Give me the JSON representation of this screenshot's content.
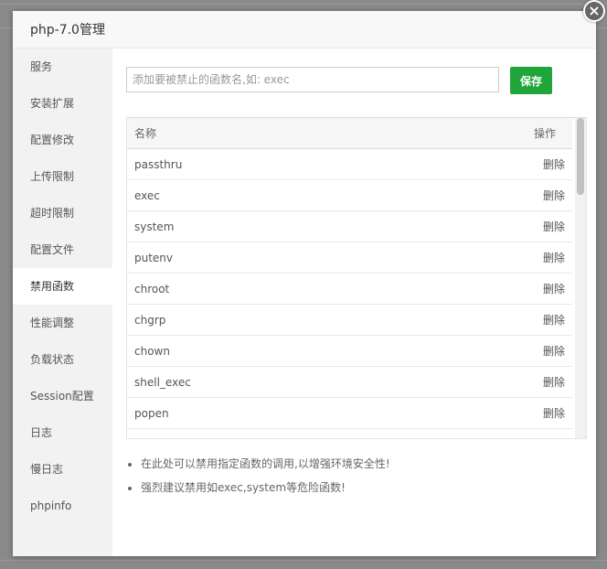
{
  "dialog": {
    "title": "php-7.0管理",
    "close_symbol": "×"
  },
  "sidebar": {
    "items": [
      {
        "label": "服务"
      },
      {
        "label": "安装扩展"
      },
      {
        "label": "配置修改"
      },
      {
        "label": "上传限制"
      },
      {
        "label": "超时限制"
      },
      {
        "label": "配置文件"
      },
      {
        "label": "禁用函数",
        "active": true
      },
      {
        "label": "性能调整"
      },
      {
        "label": "负载状态"
      },
      {
        "label": "Session配置"
      },
      {
        "label": "日志"
      },
      {
        "label": "慢日志"
      },
      {
        "label": "phpinfo"
      }
    ]
  },
  "disable_functions": {
    "input_placeholder": "添加要被禁止的函数名,如: exec",
    "input_value": "",
    "save_label": "保存",
    "table": {
      "col_name": "名称",
      "col_action": "操作",
      "action_label": "删除",
      "rows": [
        {
          "name": "passthru"
        },
        {
          "name": "exec"
        },
        {
          "name": "system"
        },
        {
          "name": "putenv"
        },
        {
          "name": "chroot"
        },
        {
          "name": "chgrp"
        },
        {
          "name": "chown"
        },
        {
          "name": "shell_exec"
        },
        {
          "name": "popen"
        }
      ]
    },
    "tips": [
      "在此处可以禁用指定函数的调用,以增强环境安全性!",
      "强烈建议禁用如exec,system等危险函数!"
    ]
  },
  "colors": {
    "accent": "#20a53a",
    "sidebar_bg": "#f2f2f2"
  }
}
